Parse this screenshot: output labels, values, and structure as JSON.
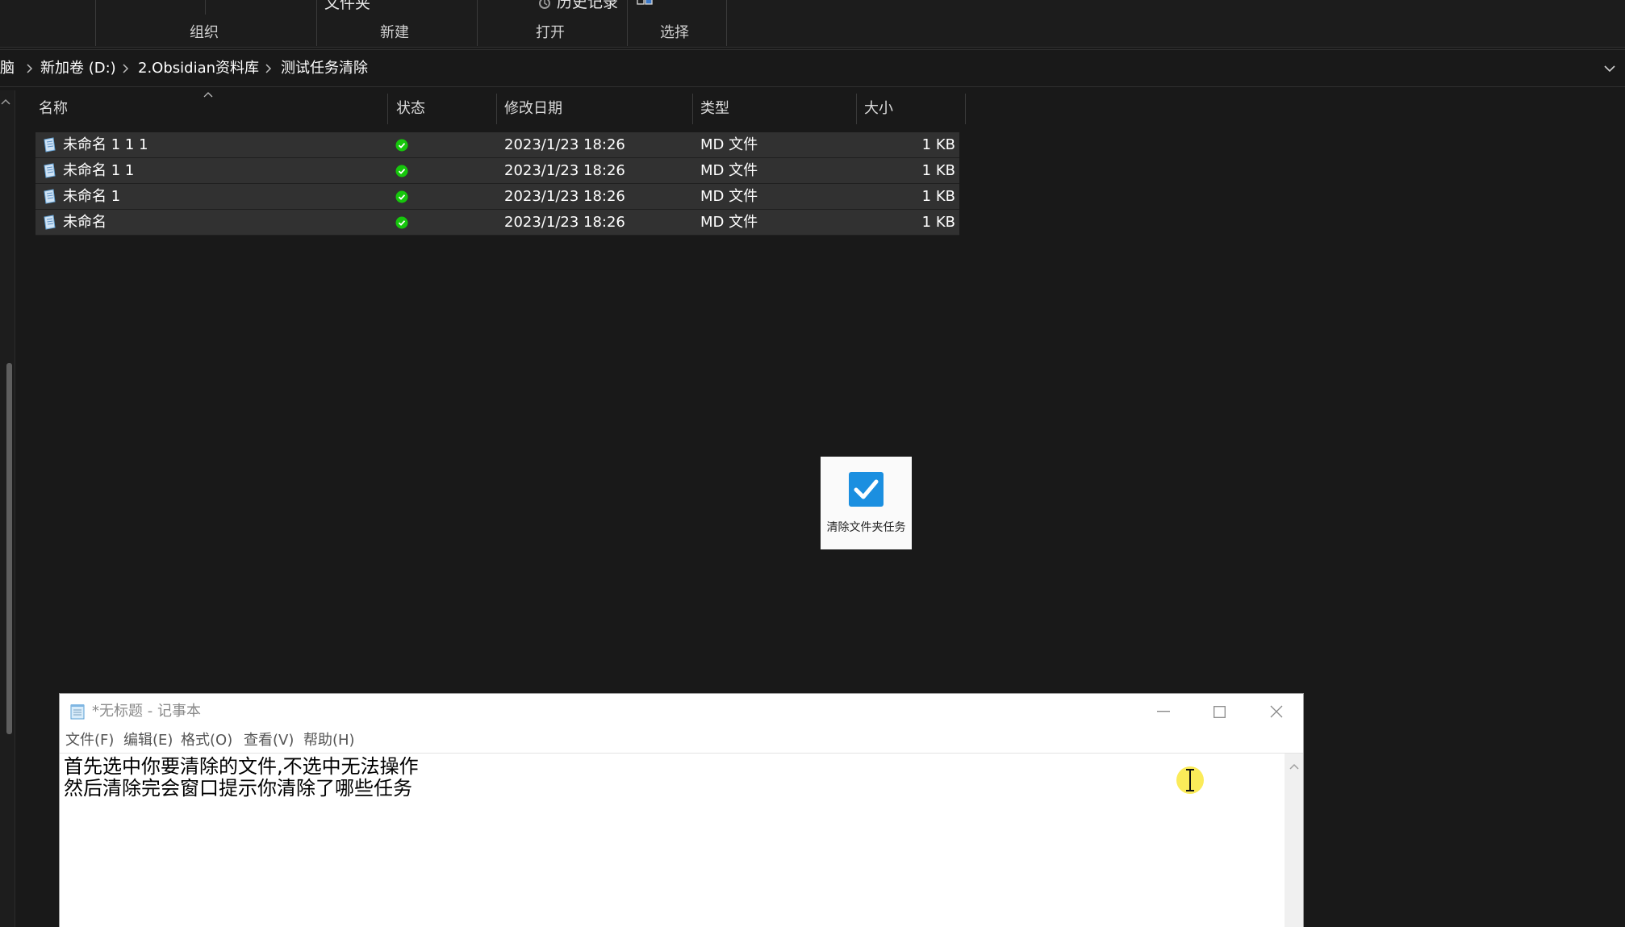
{
  "ribbon": {
    "new_folder_label": "文件夹",
    "history_label": "历史记录",
    "groups": {
      "organize": "组织",
      "new": "新建",
      "open": "打开",
      "select": "选择"
    }
  },
  "address_bar": {
    "crumbs": [
      "脑",
      "新加卷 (D:)",
      "2.Obsidian资料库",
      "测试任务清除"
    ]
  },
  "columns": {
    "name": "名称",
    "status": "状态",
    "modified": "修改日期",
    "type": "类型",
    "size": "大小"
  },
  "files": [
    {
      "name": "未命名 1 1 1",
      "date": "2023/1/23 18:26",
      "type": "MD 文件",
      "size": "1 KB",
      "status_icon": "check-circle-icon"
    },
    {
      "name": "未命名 1 1",
      "date": "2023/1/23 18:26",
      "type": "MD 文件",
      "size": "1 KB",
      "status_icon": "check-circle-icon"
    },
    {
      "name": "未命名 1",
      "date": "2023/1/23 18:26",
      "type": "MD 文件",
      "size": "1 KB",
      "status_icon": "check-circle-icon"
    },
    {
      "name": "未命名",
      "date": "2023/1/23 18:26",
      "type": "MD 文件",
      "size": "1 KB",
      "status_icon": "check-circle-icon"
    }
  ],
  "task_widget": {
    "label": "清除文件夹任务",
    "icon": "blue-checkbox-icon"
  },
  "notepad": {
    "title": "*无标题 - 记事本",
    "menu": {
      "file": "文件(F)",
      "edit": "编辑(E)",
      "format": "格式(O)",
      "view": "查看(V)",
      "help": "帮助(H)"
    },
    "lines": [
      "首先选中你要清除的文件,不选中无法操作",
      "然后清除完会窗口提示你清除了哪些任务"
    ]
  },
  "colors": {
    "explorer_bg": "#191919",
    "selected_row": "#313131",
    "status_green": "#16c60c",
    "widget_accent": "#1b8fe0",
    "cursor_highlight": "#fae83c"
  }
}
